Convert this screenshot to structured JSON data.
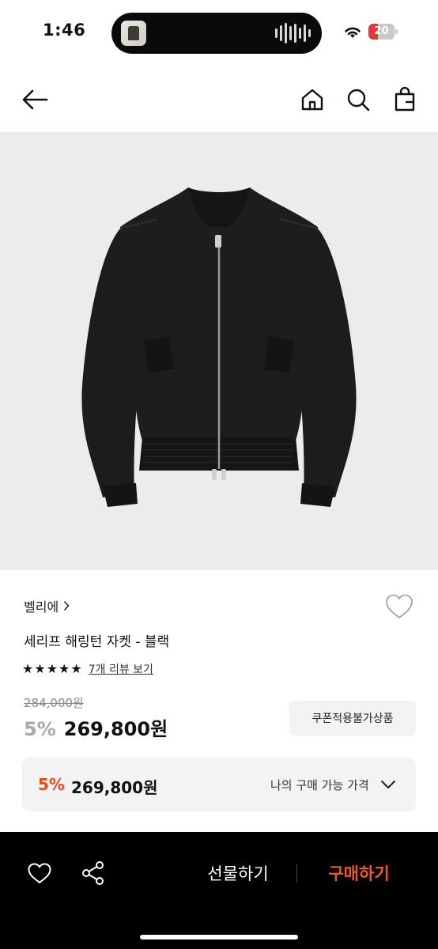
{
  "status_bar": {
    "time": "1:46",
    "battery": "20",
    "icons": [
      "wifi-icon",
      "battery-icon",
      "audio-wave-icon"
    ]
  },
  "nav": {
    "icons": [
      "back-arrow-icon",
      "home-icon",
      "search-icon",
      "shopping-bag-icon"
    ]
  },
  "product": {
    "image_icon": "black-jacket-photo",
    "brand": "벨리에",
    "title": "세리프 해링턴 자켓 - 블랙",
    "rating_stars": 5,
    "review_link": "7개 리뷰 보기",
    "original_price": "284,000원",
    "discount": "5%",
    "price": "269,800원",
    "coupon_note": "쿠폰적용불가상품"
  },
  "my_price": {
    "discount": "5%",
    "price": "269,800원",
    "label": "나의 구매 가능 가격"
  },
  "bottom_bar": {
    "gift_label": "선물하기",
    "buy_label": "구매하기"
  },
  "colors": {
    "accent": "#f05a24",
    "discount": "#e24a1c",
    "background_image": "#ececec"
  }
}
